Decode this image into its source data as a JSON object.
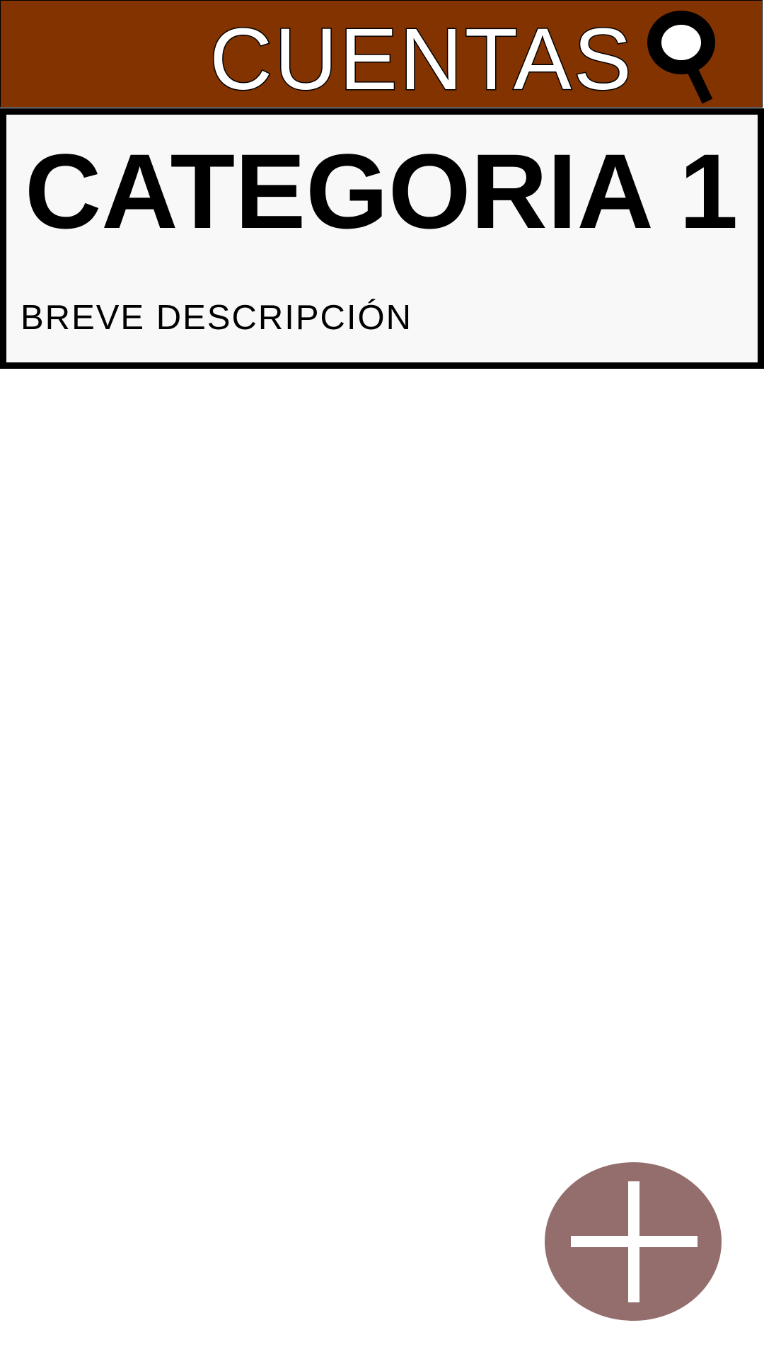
{
  "app": {
    "title": "CUENTAS",
    "colors": {
      "header": "#833300",
      "card_background": "#f8f8f8",
      "card_border": "#000000",
      "title_fill": "#ffffff",
      "text": "#000000",
      "fab": "#946d6d"
    }
  },
  "header": {
    "search_icon": "search-icon"
  },
  "category": {
    "title": "CATEGORIA 1",
    "description": "BREVE DESCRIPCIÓN"
  },
  "fab": {
    "icon": "plus-icon"
  }
}
